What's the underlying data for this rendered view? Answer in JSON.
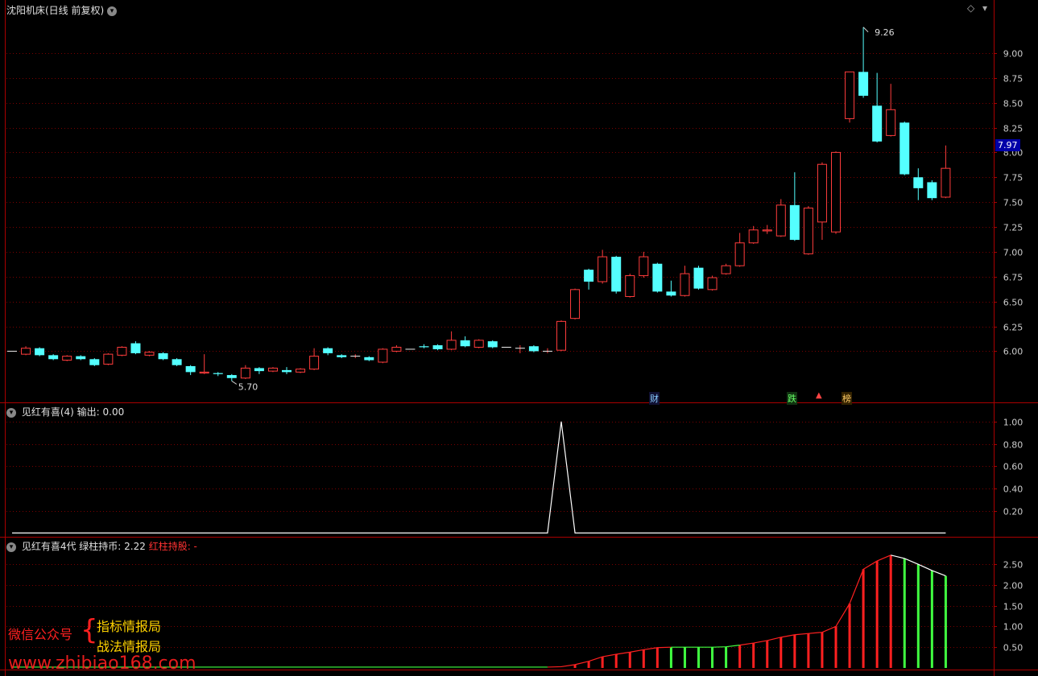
{
  "header": {
    "main_title": "沈阳机床(日线 前复权)",
    "ind1_title": "见红有喜(4) 输出: 0.00",
    "ind2_title_white": "见红有喜4代 绿柱持币: 2.22",
    "ind2_title_red": "红柱持股: -"
  },
  "watermark": {
    "left": "微信公众号",
    "line1": "指标情报局",
    "line2": "战法情报局",
    "url": "www.zhibiao168.com",
    "bottom_overlay": "微信公众号 指标情报局"
  },
  "markers": {
    "cai": "财",
    "die": "跌",
    "bang": "榜"
  },
  "colors": {
    "up": "#ff3c3c",
    "down": "#54ffff",
    "grid": "#7a0000",
    "axis": "#aa0000"
  },
  "chart_data": [
    {
      "type": "candlestick",
      "title": "沈阳机床(日线 前复权)",
      "y_ticks": [
        "9.00",
        "8.75",
        "8.50",
        "8.25",
        "8.00",
        "7.75",
        "7.50",
        "7.25",
        "7.00",
        "6.75",
        "6.50",
        "6.25",
        "6.00"
      ],
      "ylim": [
        5.55,
        9.42
      ],
      "last_price": "7.97",
      "high_label": "9.26",
      "low_label": "5.70",
      "candles": [
        [
          6.0,
          6.0,
          6.0,
          6.0
        ],
        [
          5.97,
          6.03,
          6.05,
          5.96
        ],
        [
          6.03,
          5.96,
          6.04,
          5.95
        ],
        [
          5.96,
          5.92,
          5.97,
          5.91
        ],
        [
          5.91,
          5.95,
          5.96,
          5.9
        ],
        [
          5.95,
          5.92,
          5.96,
          5.91
        ],
        [
          5.92,
          5.86,
          5.93,
          5.85
        ],
        [
          5.87,
          5.97,
          5.98,
          5.86
        ],
        [
          5.96,
          6.04,
          6.05,
          5.95
        ],
        [
          6.08,
          5.98,
          6.1,
          5.97
        ],
        [
          5.96,
          5.99,
          6.0,
          5.95
        ],
        [
          5.98,
          5.92,
          5.99,
          5.91
        ],
        [
          5.92,
          5.86,
          5.93,
          5.85
        ],
        [
          5.85,
          5.79,
          5.86,
          5.76
        ],
        [
          5.78,
          5.79,
          5.97,
          5.77
        ],
        [
          5.78,
          5.77,
          5.79,
          5.75
        ],
        [
          5.76,
          5.73,
          5.77,
          5.7
        ],
        [
          5.73,
          5.83,
          5.86,
          5.72
        ],
        [
          5.83,
          5.8,
          5.84,
          5.77
        ],
        [
          5.8,
          5.83,
          5.84,
          5.79
        ],
        [
          5.81,
          5.79,
          5.84,
          5.77
        ],
        [
          5.79,
          5.82,
          5.83,
          5.78
        ],
        [
          5.82,
          5.95,
          6.03,
          5.81
        ],
        [
          6.03,
          5.98,
          6.04,
          5.96
        ],
        [
          5.96,
          5.94,
          5.97,
          5.93
        ],
        [
          5.95,
          5.95,
          5.97,
          5.93
        ],
        [
          5.94,
          5.91,
          5.95,
          5.9
        ],
        [
          5.89,
          6.02,
          6.03,
          5.88
        ],
        [
          6.0,
          6.04,
          6.06,
          5.99
        ],
        [
          6.02,
          6.02,
          6.02,
          6.02
        ],
        [
          6.05,
          6.04,
          6.07,
          6.03
        ],
        [
          6.06,
          6.02,
          6.07,
          6.01
        ],
        [
          6.02,
          6.11,
          6.2,
          6.01
        ],
        [
          6.11,
          6.05,
          6.15,
          6.04
        ],
        [
          6.04,
          6.11,
          6.12,
          6.03
        ],
        [
          6.1,
          6.04,
          6.11,
          6.03
        ],
        [
          6.04,
          6.04,
          6.04,
          6.04
        ],
        [
          6.03,
          6.03,
          6.06,
          5.98
        ],
        [
          6.05,
          6.0,
          6.06,
          5.99
        ],
        [
          6.0,
          6.0,
          6.03,
          5.98
        ],
        [
          6.01,
          6.3,
          6.31,
          6.0
        ],
        [
          6.33,
          6.62,
          6.63,
          6.32
        ],
        [
          6.82,
          6.7,
          6.83,
          6.62
        ],
        [
          6.7,
          6.95,
          7.02,
          6.68
        ],
        [
          6.95,
          6.6,
          6.96,
          6.58
        ],
        [
          6.55,
          6.76,
          6.78,
          6.54
        ],
        [
          6.76,
          6.95,
          7.0,
          6.74
        ],
        [
          6.88,
          6.6,
          6.89,
          6.59
        ],
        [
          6.6,
          6.56,
          6.71,
          6.55
        ],
        [
          6.56,
          6.78,
          6.86,
          6.55
        ],
        [
          6.84,
          6.63,
          6.86,
          6.62
        ],
        [
          6.62,
          6.74,
          6.76,
          6.61
        ],
        [
          6.78,
          6.86,
          6.88,
          6.77
        ],
        [
          6.86,
          7.09,
          7.19,
          6.85
        ],
        [
          7.09,
          7.22,
          7.26,
          7.08
        ],
        [
          7.21,
          7.22,
          7.27,
          7.18
        ],
        [
          7.16,
          7.47,
          7.53,
          7.15
        ],
        [
          7.47,
          7.12,
          7.8,
          7.11
        ],
        [
          6.98,
          7.44,
          7.46,
          6.97
        ],
        [
          7.3,
          7.88,
          7.9,
          7.12
        ],
        [
          7.2,
          8.0,
          8.01,
          7.18
        ],
        [
          8.34,
          8.81,
          8.81,
          8.3
        ],
        [
          8.81,
          8.57,
          9.26,
          8.55
        ],
        [
          8.47,
          8.11,
          8.8,
          8.1
        ],
        [
          8.17,
          8.43,
          8.69,
          8.16
        ],
        [
          8.3,
          7.78,
          8.31,
          7.77
        ],
        [
          7.75,
          7.64,
          7.84,
          7.52
        ],
        [
          7.7,
          7.54,
          7.72,
          7.52
        ],
        [
          7.55,
          7.84,
          8.07,
          7.54
        ]
      ]
    },
    {
      "type": "line",
      "title": "见红有喜(4) 输出: 0.00",
      "y_ticks": [
        "1.00",
        "0.80",
        "0.60",
        "0.40",
        "0.20"
      ],
      "ylim": [
        -0.02,
        1.1
      ],
      "values": [
        0,
        0,
        0,
        0,
        0,
        0,
        0,
        0,
        0,
        0,
        0,
        0,
        0,
        0,
        0,
        0,
        0,
        0,
        0,
        0,
        0,
        0,
        0,
        0,
        0,
        0,
        0,
        0,
        0,
        0,
        0,
        0,
        0,
        0,
        0,
        0,
        0,
        0,
        0,
        0,
        1,
        0,
        0,
        0,
        0,
        0,
        0,
        0,
        0,
        0,
        0,
        0,
        0,
        0,
        0,
        0,
        0,
        0,
        0,
        0,
        0,
        0,
        0,
        0,
        0,
        0,
        0,
        0,
        0
      ]
    },
    {
      "type": "bar",
      "title": "见红有喜4代 绿柱持币: 2.22",
      "y_ticks": [
        "2.50",
        "2.00",
        "1.50",
        "1.00",
        "0.50"
      ],
      "ylim": [
        -0.02,
        2.95
      ],
      "values": [
        0.02,
        0.02,
        0.02,
        0.02,
        0.02,
        0.02,
        0.02,
        0.02,
        0.02,
        0.02,
        0.02,
        0.02,
        0.02,
        0.02,
        0.02,
        0.02,
        0.02,
        0.02,
        0.02,
        0.02,
        0.02,
        0.02,
        0.02,
        0.02,
        0.02,
        0.02,
        0.02,
        0.02,
        0.02,
        0.02,
        0.02,
        0.02,
        0.02,
        0.02,
        0.02,
        0.02,
        0.02,
        0.02,
        0.02,
        0.02,
        0.03,
        0.08,
        0.16,
        0.27,
        0.33,
        0.38,
        0.44,
        0.49,
        0.5,
        0.5,
        0.5,
        0.5,
        0.51,
        0.55,
        0.6,
        0.66,
        0.74,
        0.8,
        0.83,
        0.86,
        1.0,
        1.55,
        2.38,
        2.58,
        2.72,
        2.64,
        2.5,
        2.35,
        2.22
      ],
      "colors": [
        "g",
        "g",
        "g",
        "g",
        "g",
        "g",
        "g",
        "g",
        "g",
        "g",
        "g",
        "g",
        "g",
        "g",
        "g",
        "g",
        "g",
        "g",
        "g",
        "g",
        "g",
        "g",
        "g",
        "g",
        "g",
        "g",
        "g",
        "g",
        "g",
        "g",
        "g",
        "g",
        "g",
        "g",
        "g",
        "g",
        "g",
        "g",
        "g",
        "g",
        "r",
        "r",
        "r",
        "r",
        "r",
        "r",
        "r",
        "r",
        "g",
        "g",
        "g",
        "g",
        "g",
        "r",
        "r",
        "r",
        "r",
        "r",
        "r",
        "r",
        "r",
        "r",
        "r",
        "r",
        "r",
        "g",
        "g",
        "g",
        "g"
      ]
    }
  ]
}
